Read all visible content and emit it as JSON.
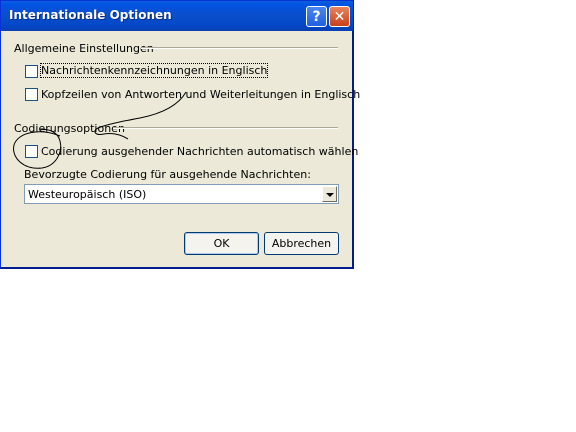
{
  "window": {
    "title": "Internationale Optionen",
    "help_glyph": "?",
    "close_glyph": "✕"
  },
  "general": {
    "heading": "Allgemeine Einstellungen",
    "options": [
      {
        "label": "Nachrichtenkennzeichnungen in Englisch",
        "checked": false
      },
      {
        "label": "Kopfzeilen von Antworten und Weiterleitungen in Englisch",
        "checked": false
      }
    ]
  },
  "encoding": {
    "heading": "Codierungsoptionen",
    "auto_option": {
      "label": "Codierung ausgehender Nachrichten automatisch wählen",
      "checked": false
    },
    "preferred_label": "Bevorzugte Codierung für ausgehende Nachrichten:",
    "preferred_value": "Westeuropäisch (ISO)"
  },
  "buttons": {
    "ok": "OK",
    "cancel": "Abbrechen"
  }
}
